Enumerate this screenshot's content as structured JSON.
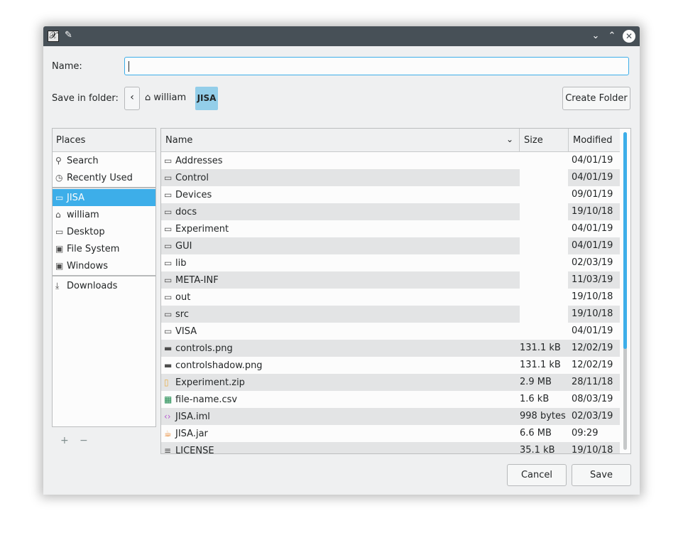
{
  "titlebar": {
    "app_icon": "x-app-icon",
    "pin_icon": "pin-icon",
    "minimize_glyph": "⌄",
    "maximize_glyph": "⌃",
    "close_glyph": "✕"
  },
  "form": {
    "name_label": "Name:",
    "name_value": "",
    "folder_label": "Save in folder:",
    "back_glyph": "‹",
    "breadcrumb": [
      {
        "icon": "home-icon",
        "label": "william"
      },
      {
        "label": "JISA",
        "active": true
      }
    ],
    "create_folder": "Create Folder"
  },
  "places": {
    "header": "Places",
    "items": [
      {
        "icon": "search-icon",
        "glyph": "⚲",
        "label": "Search"
      },
      {
        "icon": "recent-icon",
        "glyph": "◷",
        "label": "Recently Used"
      },
      {
        "icon": "folder-icon",
        "glyph": "▭",
        "label": "JISA",
        "selected": true
      },
      {
        "icon": "home-icon",
        "glyph": "⌂",
        "label": "william"
      },
      {
        "icon": "desktop-icon",
        "glyph": "▭",
        "label": "Desktop"
      },
      {
        "icon": "drive-icon",
        "glyph": "▣",
        "label": "File System"
      },
      {
        "icon": "drive-icon",
        "glyph": "▣",
        "label": "Windows"
      },
      {
        "icon": "download-icon",
        "glyph": "⤓",
        "label": "Downloads"
      }
    ],
    "add_glyph": "+",
    "remove_glyph": "−"
  },
  "files": {
    "columns": {
      "name": "Name",
      "size": "Size",
      "modified": "Modified"
    },
    "sort_glyph": "⌄",
    "rows": [
      {
        "icon": "folder-icon",
        "glyph": "▭",
        "name": "Addresses",
        "size": "",
        "modified": "04/01/19"
      },
      {
        "icon": "folder-icon",
        "glyph": "▭",
        "name": "Control",
        "size": "",
        "modified": "04/01/19"
      },
      {
        "icon": "folder-icon",
        "glyph": "▭",
        "name": "Devices",
        "size": "",
        "modified": "09/01/19"
      },
      {
        "icon": "folder-icon",
        "glyph": "▭",
        "name": "docs",
        "size": "",
        "modified": "19/10/18"
      },
      {
        "icon": "folder-icon",
        "glyph": "▭",
        "name": "Experiment",
        "size": "",
        "modified": "04/01/19"
      },
      {
        "icon": "folder-icon",
        "glyph": "▭",
        "name": "GUI",
        "size": "",
        "modified": "04/01/19"
      },
      {
        "icon": "folder-icon",
        "glyph": "▭",
        "name": "lib",
        "size": "",
        "modified": "02/03/19"
      },
      {
        "icon": "folder-icon",
        "glyph": "▭",
        "name": "META-INF",
        "size": "",
        "modified": "11/03/19"
      },
      {
        "icon": "folder-icon",
        "glyph": "▭",
        "name": "out",
        "size": "",
        "modified": "19/10/18"
      },
      {
        "icon": "folder-icon",
        "glyph": "▭",
        "name": "src",
        "size": "",
        "modified": "19/10/18"
      },
      {
        "icon": "folder-icon",
        "glyph": "▭",
        "name": "VISA",
        "size": "",
        "modified": "04/01/19"
      },
      {
        "icon": "image-file-icon",
        "glyph": "▬",
        "name": "controls.png",
        "size": "131.1 kB",
        "modified": "12/02/19"
      },
      {
        "icon": "image-file-icon",
        "glyph": "▬",
        "name": "controlshadow.png",
        "size": "131.1 kB",
        "modified": "12/02/19"
      },
      {
        "icon": "archive-file-icon",
        "glyph": "▯",
        "name": "Experiment.zip",
        "size": "2.9 MB",
        "modified": "28/11/18"
      },
      {
        "icon": "spreadsheet-file-icon",
        "glyph": "▦",
        "name": "file-name.csv",
        "size": "1.6 kB",
        "modified": "08/03/19"
      },
      {
        "icon": "code-file-icon",
        "glyph": "‹›",
        "name": "JISA.iml",
        "size": "998 bytes",
        "modified": "02/03/19"
      },
      {
        "icon": "java-file-icon",
        "glyph": "☕",
        "name": "JISA.jar",
        "size": "6.6 MB",
        "modified": "09:29"
      },
      {
        "icon": "text-file-icon",
        "glyph": "≡",
        "name": "LICENSE",
        "size": "35.1 kB",
        "modified": "19/10/18"
      }
    ]
  },
  "buttons": {
    "cancel": "Cancel",
    "save": "Save"
  },
  "colors": {
    "accent": "#3daee9",
    "titlebar": "#475057",
    "breadcrumb_active": "#93cee9"
  }
}
